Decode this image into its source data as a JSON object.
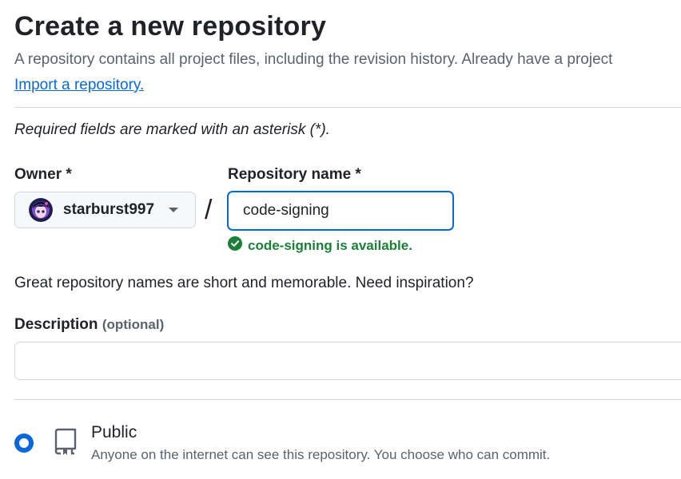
{
  "header": {
    "title": "Create a new repository",
    "subtitle": "A repository contains all project files, including the revision history. Already have a project",
    "import_link": "Import a repository."
  },
  "form": {
    "required_note": "Required fields are marked with an asterisk (*).",
    "owner": {
      "label": "Owner *",
      "value": "starburst997"
    },
    "separator": "/",
    "repo_name": {
      "label": "Repository name *",
      "value": "code-signing",
      "availability": "code-signing is available."
    },
    "hint": "Great repository names are short and memorable. Need inspiration?",
    "description": {
      "label": "Description",
      "optional": "(optional)",
      "value": ""
    },
    "visibility": {
      "public": {
        "title": "Public",
        "description": "Anyone on the internet can see this repository. You choose who can commit.",
        "selected": true
      }
    }
  },
  "colors": {
    "accent": "#0969da",
    "success": "#1a7f37",
    "muted": "#59636e",
    "border": "#d1d9e0"
  },
  "icons": {
    "owner_caret": "triangle-down-icon",
    "availability": "check-circle-fill-icon",
    "public": "repo-icon"
  }
}
